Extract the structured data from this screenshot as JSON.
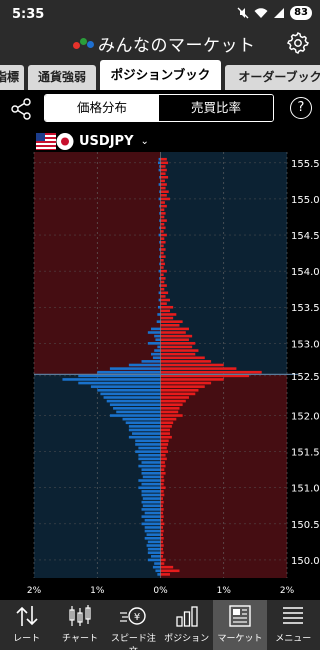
{
  "status": {
    "time": "5:35",
    "battery": "83"
  },
  "app": {
    "title": "みんなのマーケット"
  },
  "tabs": [
    {
      "label": "指標"
    },
    {
      "label": "通貨強弱"
    },
    {
      "label": "ポジションブック"
    },
    {
      "label": "オーダーブック"
    }
  ],
  "toggle": {
    "left": "価格分布",
    "right": "売買比率",
    "selected": "right"
  },
  "help": "?",
  "pair": {
    "label": "USDJPY"
  },
  "colors": {
    "sell_bar": "#e61c1c",
    "buy_bar": "#1a72cc",
    "sell_zone": "#450d12",
    "buy_zone": "#0c2233",
    "current_line": "#5a7a9a"
  },
  "chart_data": {
    "type": "bar",
    "orientation": "horizontal",
    "current_price": 152.57,
    "ylim": [
      149.75,
      155.65
    ],
    "y_ticks": [
      "155.50",
      "155.00",
      "154.50",
      "154.00",
      "153.50",
      "153.00",
      "152.55",
      "152.00",
      "151.50",
      "151.00",
      "150.50",
      "150.00"
    ],
    "x_ticks": [
      "2%",
      "1%",
      "0%",
      "1%",
      "2%"
    ],
    "xlim_percent": 2,
    "series": [
      {
        "side": "right",
        "values": [
          [
            155.55,
            0.1
          ],
          [
            155.5,
            0.12
          ],
          [
            155.45,
            0.08
          ],
          [
            155.4,
            0.1
          ],
          [
            155.35,
            0.08
          ],
          [
            155.3,
            0.12
          ],
          [
            155.25,
            0.07
          ],
          [
            155.2,
            0.1
          ],
          [
            155.15,
            0.08
          ],
          [
            155.1,
            0.13
          ],
          [
            155.05,
            0.1
          ],
          [
            155.0,
            0.15
          ],
          [
            154.95,
            0.07
          ],
          [
            154.9,
            0.1
          ],
          [
            154.85,
            0.06
          ],
          [
            154.8,
            0.08
          ],
          [
            154.75,
            0.06
          ],
          [
            154.7,
            0.1
          ],
          [
            154.65,
            0.06
          ],
          [
            154.6,
            0.08
          ],
          [
            154.55,
            0.05
          ],
          [
            154.5,
            0.1
          ],
          [
            154.45,
            0.06
          ],
          [
            154.4,
            0.08
          ],
          [
            154.35,
            0.05
          ],
          [
            154.3,
            0.08
          ],
          [
            154.25,
            0.05
          ],
          [
            154.2,
            0.08
          ],
          [
            154.15,
            0.05
          ],
          [
            154.1,
            0.07
          ],
          [
            154.05,
            0.05
          ],
          [
            154.0,
            0.1
          ],
          [
            153.95,
            0.05
          ],
          [
            153.9,
            0.08
          ],
          [
            153.85,
            0.06
          ],
          [
            153.8,
            0.1
          ],
          [
            153.75,
            0.06
          ],
          [
            153.7,
            0.12
          ],
          [
            153.65,
            0.08
          ],
          [
            153.6,
            0.15
          ],
          [
            153.55,
            0.1
          ],
          [
            153.5,
            0.2
          ],
          [
            153.45,
            0.15
          ],
          [
            153.4,
            0.25
          ],
          [
            153.35,
            0.2
          ],
          [
            153.3,
            0.35
          ],
          [
            153.25,
            0.3
          ],
          [
            153.2,
            0.45
          ],
          [
            153.15,
            0.4
          ],
          [
            153.1,
            0.5
          ],
          [
            153.05,
            0.45
          ],
          [
            153.0,
            0.55
          ],
          [
            152.95,
            0.5
          ],
          [
            152.9,
            0.6
          ],
          [
            152.85,
            0.55
          ],
          [
            152.8,
            0.7
          ],
          [
            152.75,
            0.8
          ],
          [
            152.7,
            1.0
          ],
          [
            152.65,
            1.2
          ],
          [
            152.6,
            1.6
          ],
          [
            152.55,
            1.4
          ],
          [
            152.5,
            1.0
          ],
          [
            152.45,
            0.8
          ],
          [
            152.4,
            0.7
          ],
          [
            152.35,
            0.6
          ],
          [
            152.3,
            0.55
          ],
          [
            152.25,
            0.45
          ],
          [
            152.2,
            0.4
          ],
          [
            152.15,
            0.35
          ],
          [
            152.1,
            0.3
          ],
          [
            152.05,
            0.28
          ],
          [
            152.0,
            0.35
          ],
          [
            151.95,
            0.25
          ],
          [
            151.9,
            0.2
          ],
          [
            151.85,
            0.18
          ],
          [
            151.8,
            0.15
          ],
          [
            151.75,
            0.15
          ],
          [
            151.7,
            0.18
          ],
          [
            151.65,
            0.13
          ],
          [
            151.6,
            0.12
          ],
          [
            151.55,
            0.1
          ],
          [
            151.5,
            0.12
          ],
          [
            151.45,
            0.08
          ],
          [
            151.4,
            0.1
          ],
          [
            151.35,
            0.07
          ],
          [
            151.3,
            0.08
          ],
          [
            151.25,
            0.06
          ],
          [
            151.2,
            0.08
          ],
          [
            151.15,
            0.05
          ],
          [
            151.1,
            0.06
          ],
          [
            151.05,
            0.05
          ],
          [
            151.0,
            0.08
          ],
          [
            150.95,
            0.05
          ],
          [
            150.9,
            0.06
          ],
          [
            150.85,
            0.04
          ],
          [
            150.8,
            0.05
          ],
          [
            150.75,
            0.04
          ],
          [
            150.7,
            0.05
          ],
          [
            150.65,
            0.04
          ],
          [
            150.6,
            0.05
          ],
          [
            150.55,
            0.04
          ],
          [
            150.5,
            0.06
          ],
          [
            150.45,
            0.04
          ],
          [
            150.4,
            0.05
          ],
          [
            150.35,
            0.04
          ],
          [
            150.3,
            0.05
          ],
          [
            150.25,
            0.04
          ],
          [
            150.2,
            0.05
          ],
          [
            150.15,
            0.04
          ],
          [
            150.1,
            0.05
          ],
          [
            150.05,
            0.04
          ],
          [
            150.0,
            0.08
          ],
          [
            149.95,
            0.06
          ],
          [
            149.9,
            0.2
          ],
          [
            149.85,
            0.3
          ],
          [
            149.8,
            0.15
          ]
        ]
      },
      {
        "side": "left",
        "values": [
          [
            155.55,
            0.03
          ],
          [
            155.5,
            0.04
          ],
          [
            155.45,
            0.02
          ],
          [
            155.4,
            0.03
          ],
          [
            155.3,
            0.02
          ],
          [
            155.2,
            0.03
          ],
          [
            155.1,
            0.02
          ],
          [
            155.0,
            0.03
          ],
          [
            154.9,
            0.02
          ],
          [
            154.8,
            0.02
          ],
          [
            154.7,
            0.02
          ],
          [
            154.6,
            0.02
          ],
          [
            154.5,
            0.03
          ],
          [
            154.4,
            0.02
          ],
          [
            154.3,
            0.02
          ],
          [
            154.2,
            0.02
          ],
          [
            154.1,
            0.02
          ],
          [
            154.0,
            0.03
          ],
          [
            153.9,
            0.02
          ],
          [
            153.8,
            0.02
          ],
          [
            153.7,
            0.03
          ],
          [
            153.6,
            0.03
          ],
          [
            153.5,
            0.04
          ],
          [
            153.4,
            0.05
          ],
          [
            153.3,
            0.06
          ],
          [
            153.2,
            0.15
          ],
          [
            153.15,
            0.2
          ],
          [
            153.1,
            0.1
          ],
          [
            153.05,
            0.08
          ],
          [
            153.0,
            0.2
          ],
          [
            152.95,
            0.05
          ],
          [
            152.9,
            0.1
          ],
          [
            152.85,
            0.15
          ],
          [
            152.8,
            0.12
          ],
          [
            152.75,
            0.3
          ],
          [
            152.7,
            0.5
          ],
          [
            152.65,
            0.8
          ],
          [
            152.6,
            1.0
          ],
          [
            152.55,
            1.3
          ],
          [
            152.5,
            1.55
          ],
          [
            152.45,
            1.3
          ],
          [
            152.4,
            1.1
          ],
          [
            152.35,
            1.0
          ],
          [
            152.3,
            0.95
          ],
          [
            152.25,
            0.9
          ],
          [
            152.2,
            0.85
          ],
          [
            152.15,
            0.8
          ],
          [
            152.1,
            0.75
          ],
          [
            152.05,
            0.7
          ],
          [
            152.0,
            0.8
          ],
          [
            151.95,
            0.6
          ],
          [
            151.9,
            0.55
          ],
          [
            151.85,
            0.5
          ],
          [
            151.8,
            0.5
          ],
          [
            151.75,
            0.45
          ],
          [
            151.7,
            0.5
          ],
          [
            151.65,
            0.4
          ],
          [
            151.6,
            0.4
          ],
          [
            151.55,
            0.35
          ],
          [
            151.5,
            0.4
          ],
          [
            151.45,
            0.35
          ],
          [
            151.4,
            0.35
          ],
          [
            151.35,
            0.3
          ],
          [
            151.3,
            0.35
          ],
          [
            151.25,
            0.3
          ],
          [
            151.2,
            0.3
          ],
          [
            151.15,
            0.28
          ],
          [
            151.1,
            0.35
          ],
          [
            151.05,
            0.3
          ],
          [
            151.0,
            0.35
          ],
          [
            150.95,
            0.3
          ],
          [
            150.9,
            0.3
          ],
          [
            150.85,
            0.28
          ],
          [
            150.8,
            0.3
          ],
          [
            150.75,
            0.28
          ],
          [
            150.7,
            0.3
          ],
          [
            150.65,
            0.25
          ],
          [
            150.6,
            0.3
          ],
          [
            150.55,
            0.25
          ],
          [
            150.5,
            0.3
          ],
          [
            150.45,
            0.25
          ],
          [
            150.4,
            0.25
          ],
          [
            150.35,
            0.22
          ],
          [
            150.3,
            0.25
          ],
          [
            150.25,
            0.2
          ],
          [
            150.2,
            0.22
          ],
          [
            150.15,
            0.2
          ],
          [
            150.1,
            0.2
          ],
          [
            150.05,
            0.15
          ],
          [
            150.0,
            0.2
          ],
          [
            149.95,
            0.1
          ],
          [
            149.9,
            0.12
          ],
          [
            149.85,
            0.08
          ],
          [
            149.8,
            0.05
          ]
        ]
      }
    ]
  },
  "bottom_nav": [
    {
      "label": "レート",
      "icon": "rate-arrows-icon"
    },
    {
      "label": "チャート",
      "icon": "candlestick-icon"
    },
    {
      "label": "スピード注文",
      "icon": "yen-speed-icon"
    },
    {
      "label": "ポジション",
      "icon": "position-bars-icon"
    },
    {
      "label": "マーケット",
      "icon": "market-news-icon",
      "active": true
    },
    {
      "label": "メニュー",
      "icon": "menu-lines-icon"
    }
  ]
}
